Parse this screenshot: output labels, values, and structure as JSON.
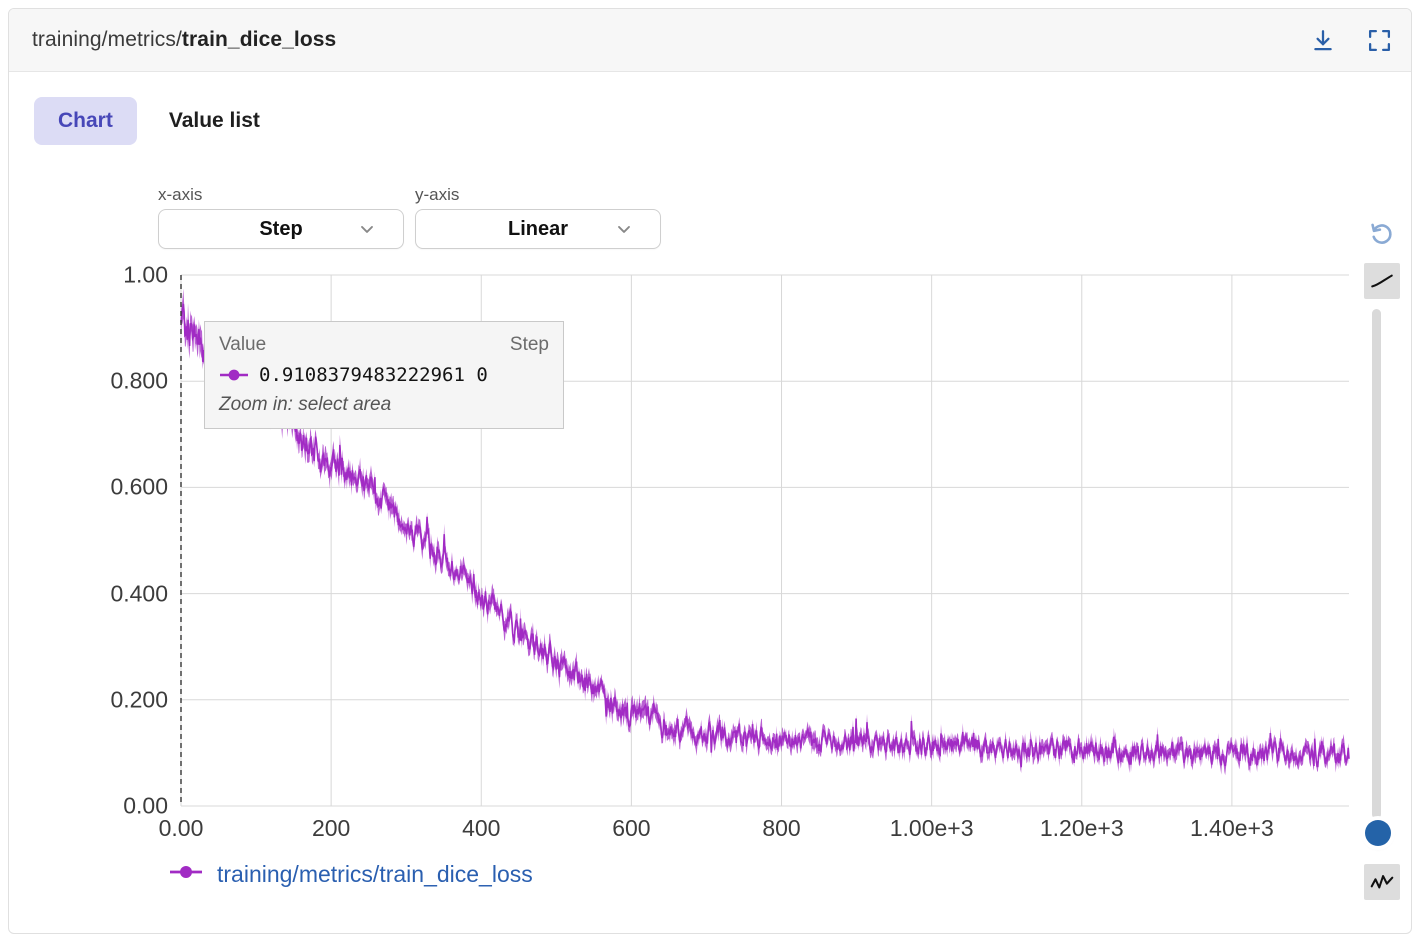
{
  "header": {
    "title_prefix": "training/metrics/",
    "title_metric": "train_dice_loss",
    "download_icon": "download-icon",
    "fullscreen_icon": "fullscreen-icon"
  },
  "tabs": [
    {
      "label": "Chart",
      "active": true
    },
    {
      "label": "Value list",
      "active": false
    }
  ],
  "controls": {
    "x_axis": {
      "label": "x-axis",
      "value": "Step"
    },
    "y_axis": {
      "label": "y-axis",
      "value": "Linear"
    }
  },
  "tooltip": {
    "col_value": "Value",
    "col_step": "Step",
    "value": "0.9108379483222961",
    "step": "0",
    "hint": "Zoom in: select area"
  },
  "legend": [
    {
      "label": "training/metrics/train_dice_loss",
      "color": "#a12bc4"
    }
  ],
  "toolbar": {
    "reset_icon": "reset-zoom-icon",
    "smooth_icon": "smooth-curve-icon",
    "raw_icon": "raw-line-icon",
    "slider_name": "smoothing-slider"
  },
  "colors": {
    "series": "#a12bc4",
    "accent_blue": "#2a5fa8",
    "tab_active_bg": "#dcdcf5",
    "tab_active_fg": "#4747b8",
    "grid": "#d8d8d8"
  },
  "chart_data": {
    "type": "line",
    "title": "training/metrics/train_dice_loss",
    "xlabel": "Step",
    "ylabel": "",
    "xlim": [
      0,
      1556
    ],
    "ylim": [
      0,
      1.0
    ],
    "grid": true,
    "legend_position": "bottom-left",
    "x_ticks": [
      0,
      200,
      400,
      600,
      800,
      1000,
      1200,
      1400
    ],
    "x_tick_labels": [
      "0.00",
      "200",
      "400",
      "600",
      "800",
      "1.00e+3",
      "1.20e+3",
      "1.40e+3"
    ],
    "y_ticks": [
      0.0,
      0.2,
      0.4,
      0.6,
      0.8,
      1.0
    ],
    "y_tick_labels": [
      "0.00",
      "0.200",
      "0.400",
      "0.600",
      "0.800",
      "1.00"
    ],
    "crosshair_step": 0,
    "series": [
      {
        "name": "training/metrics/train_dice_loss",
        "color": "#a12bc4",
        "noise_band": true,
        "points": [
          [
            0,
            0.911
          ],
          [
            10,
            0.893
          ],
          [
            20,
            0.878
          ],
          [
            30,
            0.868
          ],
          [
            40,
            0.86
          ],
          [
            55,
            0.852
          ],
          [
            70,
            0.846
          ],
          [
            85,
            0.838
          ],
          [
            100,
            0.82
          ],
          [
            120,
            0.78
          ],
          [
            140,
            0.735
          ],
          [
            160,
            0.695
          ],
          [
            180,
            0.668
          ],
          [
            195,
            0.65
          ],
          [
            210,
            0.64
          ],
          [
            230,
            0.618
          ],
          [
            250,
            0.596
          ],
          [
            270,
            0.57
          ],
          [
            290,
            0.54
          ],
          [
            310,
            0.515
          ],
          [
            330,
            0.492
          ],
          [
            350,
            0.47
          ],
          [
            370,
            0.44
          ],
          [
            390,
            0.408
          ],
          [
            410,
            0.382
          ],
          [
            430,
            0.356
          ],
          [
            450,
            0.33
          ],
          [
            470,
            0.305
          ],
          [
            490,
            0.282
          ],
          [
            510,
            0.262
          ],
          [
            530,
            0.24
          ],
          [
            550,
            0.218
          ],
          [
            570,
            0.198
          ],
          [
            590,
            0.182
          ],
          [
            610,
            0.168
          ],
          [
            630,
            0.158
          ],
          [
            650,
            0.15
          ],
          [
            675,
            0.143
          ],
          [
            700,
            0.138
          ],
          [
            730,
            0.133
          ],
          [
            760,
            0.13
          ],
          [
            800,
            0.126
          ],
          [
            840,
            0.122
          ],
          [
            880,
            0.12
          ],
          [
            920,
            0.118
          ],
          [
            960,
            0.115
          ],
          [
            1000,
            0.113
          ],
          [
            1050,
            0.11
          ],
          [
            1100,
            0.108
          ],
          [
            1150,
            0.107
          ],
          [
            1200,
            0.105
          ],
          [
            1250,
            0.103
          ],
          [
            1300,
            0.102
          ],
          [
            1350,
            0.1
          ],
          [
            1400,
            0.099
          ],
          [
            1450,
            0.098
          ],
          [
            1500,
            0.097
          ],
          [
            1556,
            0.096
          ]
        ],
        "noise_amplitude": [
          [
            0,
            0.055
          ],
          [
            100,
            0.05
          ],
          [
            200,
            0.04
          ],
          [
            300,
            0.035
          ],
          [
            400,
            0.035
          ],
          [
            500,
            0.038
          ],
          [
            600,
            0.035
          ],
          [
            800,
            0.032
          ],
          [
            1000,
            0.03
          ],
          [
            1200,
            0.03
          ],
          [
            1556,
            0.032
          ]
        ]
      }
    ]
  }
}
